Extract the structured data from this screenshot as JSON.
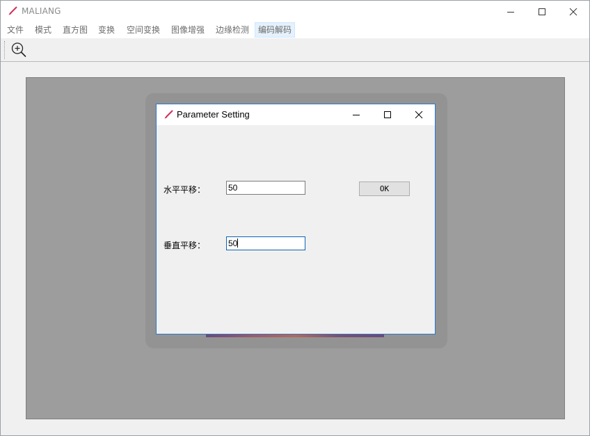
{
  "app": {
    "title": "MALIANG",
    "icon": "brush-icon",
    "accent_color": "#d0305a"
  },
  "window_controls": {
    "minimize": "minimize-icon",
    "maximize": "maximize-icon",
    "close": "close-icon"
  },
  "menu": {
    "items": [
      "文件",
      "模式",
      "直方图",
      "变换",
      "空间变换",
      "图像增强",
      "边缘检测",
      "编码解码"
    ],
    "active_index": 7
  },
  "toolbar": {
    "tools": [
      {
        "icon": "zoom-in-icon"
      }
    ]
  },
  "dialog": {
    "title": "Parameter Setting",
    "fields": [
      {
        "label": "水平平移：",
        "value": "50"
      },
      {
        "label": "垂直平移：",
        "value": "50"
      }
    ],
    "ok_label": "OK"
  }
}
